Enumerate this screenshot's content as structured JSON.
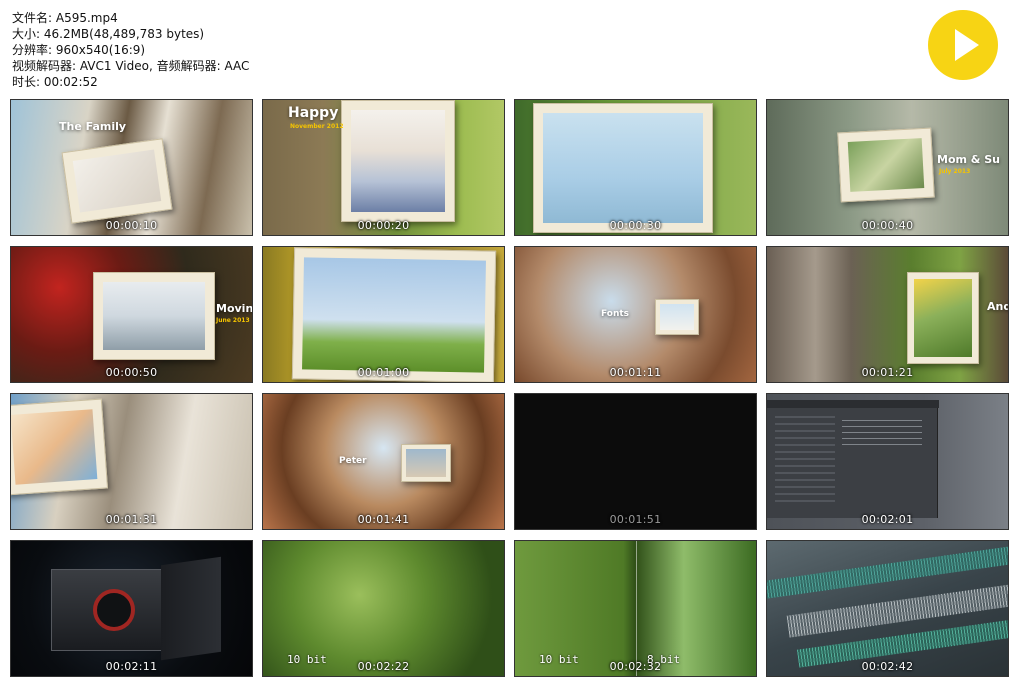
{
  "file_info": {
    "name_line": "文件名: A595.mp4",
    "size_line": "大小: 46.2MB(48,489,783 bytes)",
    "resolution_line": "分辨率: 960x540(16:9)",
    "codec_line": "视频解码器: AVC1 Video, 音频解码器: AAC",
    "duration_line": "时长: 00:02:52"
  },
  "play_icon": "play-circle-icon",
  "accent_color": "#f7d414",
  "thumbnails": [
    {
      "time": "00:00:10",
      "caption": "The Family",
      "subtitle": ""
    },
    {
      "time": "00:00:20",
      "caption": "Happy",
      "subtitle": "November 2012"
    },
    {
      "time": "00:00:30",
      "caption": "",
      "subtitle": ""
    },
    {
      "time": "00:00:40",
      "caption": "Mom & Su",
      "subtitle": "July 2013"
    },
    {
      "time": "00:00:50",
      "caption": "Movin",
      "subtitle": "June 2013"
    },
    {
      "time": "00:01:00",
      "caption": "",
      "subtitle": ""
    },
    {
      "time": "00:01:11",
      "caption": "Fonts",
      "subtitle": ""
    },
    {
      "time": "00:01:21",
      "caption": "And",
      "subtitle": ""
    },
    {
      "time": "00:01:31",
      "caption": "",
      "subtitle": ""
    },
    {
      "time": "00:01:41",
      "caption": "Peter",
      "subtitle": ""
    },
    {
      "time": "00:01:51",
      "caption": "",
      "subtitle": ""
    },
    {
      "time": "00:02:01",
      "caption": "",
      "subtitle": ""
    },
    {
      "time": "00:02:11",
      "caption": "",
      "subtitle": ""
    },
    {
      "time": "00:02:22",
      "caption": "",
      "subtitle": "",
      "overlay_left": "10 bit"
    },
    {
      "time": "00:02:32",
      "caption": "",
      "subtitle": "",
      "overlay_left": "10 bit",
      "overlay_right": "8 bit"
    },
    {
      "time": "00:02:42",
      "caption": "",
      "subtitle": ""
    }
  ]
}
